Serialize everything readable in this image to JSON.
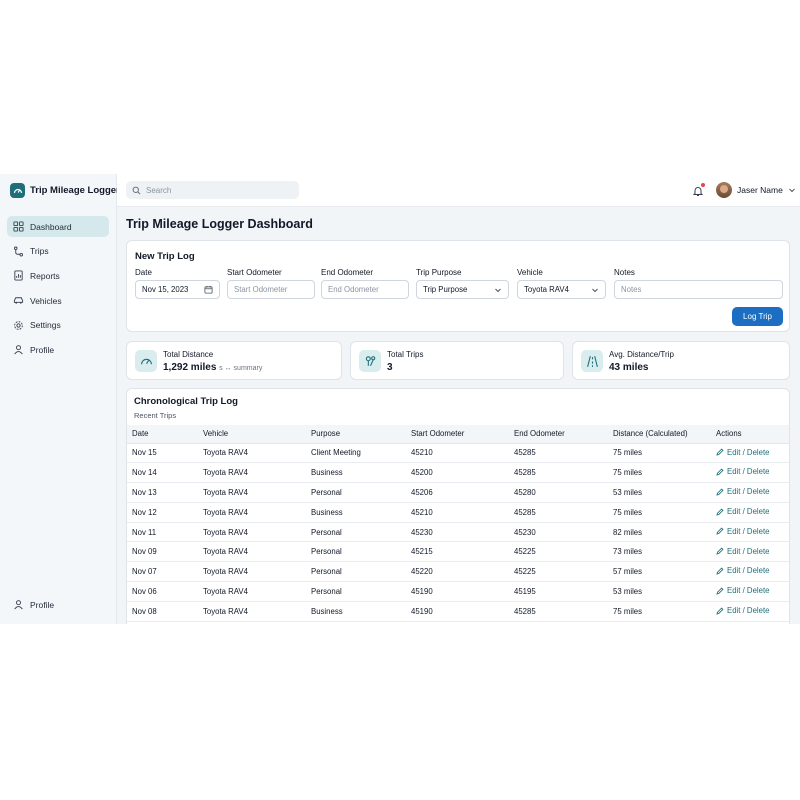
{
  "app": {
    "name": "Trip Mileage Logger",
    "brand_color": "#1f6f7a"
  },
  "sidebar": {
    "items": [
      {
        "label": "Dashboard",
        "icon": "dashboard-icon",
        "active": true
      },
      {
        "label": "Trips",
        "icon": "route-icon"
      },
      {
        "label": "Reports",
        "icon": "report-icon"
      },
      {
        "label": "Vehicles",
        "icon": "car-icon"
      },
      {
        "label": "Settings",
        "icon": "gear-icon"
      },
      {
        "label": "Profile",
        "icon": "user-icon"
      }
    ],
    "footer": {
      "label": "Profile",
      "icon": "user-icon"
    }
  },
  "topbar": {
    "search_placeholder": "Search",
    "user_name": "Jaser Name"
  },
  "page_title": "Trip Mileage Logger Dashboard",
  "form": {
    "title": "New Trip Log",
    "date": {
      "label": "Date",
      "value": "Nov 15, 2023"
    },
    "start_odometer": {
      "label": "Start Odometer",
      "placeholder": "Start Odometer"
    },
    "end_odometer": {
      "label": "End Odometer",
      "placeholder": "End Odometer"
    },
    "purpose": {
      "label": "Trip Purpose",
      "value": "Trip Purpose"
    },
    "vehicle": {
      "label": "Vehicle",
      "value": "Toyota RAV4"
    },
    "notes": {
      "label": "Notes",
      "placeholder": "Notes"
    },
    "submit_label": "Log Trip",
    "submit_color": "#1b6ec2"
  },
  "stats": [
    {
      "label": "Total Distance",
      "value": "1,292 miles",
      "sub": "s ↔ summary",
      "icon": "speedometer-icon"
    },
    {
      "label": "Total Trips",
      "value": "3",
      "sub": "",
      "icon": "route-pin-icon"
    },
    {
      "label": "Avg. Distance/Trip",
      "value": "43 miles",
      "sub": "",
      "icon": "road-icon"
    }
  ],
  "log": {
    "title": "Chronological Trip Log",
    "subtitle": "Recent Trips",
    "columns": [
      "Date",
      "Vehicle",
      "Purpose",
      "Start Odometer",
      "End Odometer",
      "Distance (Calculated)",
      "Actions"
    ],
    "action_label": "Edit / Delete",
    "rows": [
      [
        "Nov 15",
        "Toyota RAV4",
        "Client Meeting",
        "45210",
        "45285",
        "75 miles"
      ],
      [
        "Nov 14",
        "Toyota RAV4",
        "Business",
        "45200",
        "45285",
        "75 miles"
      ],
      [
        "Nov 13",
        "Toyota RAV4",
        "Personal",
        "45206",
        "45280",
        "53 miles"
      ],
      [
        "Nov 12",
        "Toyota RAV4",
        "Business",
        "45210",
        "45285",
        "75 miles"
      ],
      [
        "Nov 11",
        "Toyota RAV4",
        "Personal",
        "45230",
        "45230",
        "82 miles"
      ],
      [
        "Nov 09",
        "Toyota RAV4",
        "Personal",
        "45215",
        "45225",
        "73 miles"
      ],
      [
        "Nov 07",
        "Toyota RAV4",
        "Personal",
        "45220",
        "45225",
        "57 miles"
      ],
      [
        "Nov 06",
        "Toyota RAV4",
        "Personal",
        "45190",
        "45195",
        "53 miles"
      ],
      [
        "Nov 08",
        "Toyota RAV4",
        "Business",
        "45190",
        "45285",
        "75 miles"
      ]
    ]
  }
}
